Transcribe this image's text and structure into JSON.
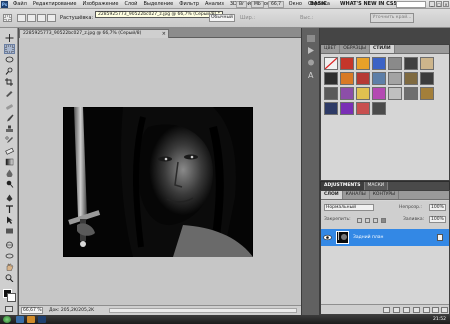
{
  "app": {
    "logo_text": "Ps",
    "menu": [
      "Файл",
      "Редактирование",
      "Изображение",
      "Слой",
      "Выделение",
      "Фильтр",
      "Анализ",
      "3D-слой",
      "Просмотр",
      "Окно",
      "Справка"
    ],
    "bar_buttons": [
      "Br",
      "Mb"
    ],
    "zoom_button": "66,7",
    "workspace_basic": "BASIC",
    "workspace_whatsnew": "WHAT'S NEW IN CS5",
    "window_controls": [
      "_",
      "□",
      "×"
    ]
  },
  "options": {
    "feather_label": "Растушёвка:",
    "feather_value": "0 пикс",
    "style_value": "Обычный",
    "width_label": "Шир.:",
    "height_label": "Выс.:",
    "refine_edge": "Уточнить край..."
  },
  "document": {
    "tab_title": "2285925773_90522bc027_z.jpg @ 66,7% (Серый/8)",
    "tooltip": "2285925773_90522bc027_z.jpg @ 66,7% (Серый/8) *",
    "zoom": "66,67 %",
    "doc_size": "Док: 205,2K/205,2K"
  },
  "panels": {
    "top_tabs": [
      "ЦВЕТ",
      "ОБРАЗЦЫ",
      "СТИЛИ"
    ],
    "top_active": 2,
    "adj_tabs": [
      "ADJUSTMENTS",
      "МАСКИ"
    ],
    "layer_tabs": [
      "СЛОИ",
      "КАНАЛЫ",
      "КОНТУРЫ"
    ],
    "blend_mode": "Нормальный",
    "opacity_label": "Непрозр.:",
    "opacity_value": "100%",
    "lock_label": "Закрепить:",
    "fill_label": "Заливка:",
    "fill_value": "100%",
    "layer_name": "Задний план"
  },
  "styles": {
    "swatch_colors": [
      "#f1f1f1",
      "#c5362a",
      "#e8a128",
      "#3c63c6",
      "#8a8a8a",
      "#404040",
      "#cdb58b",
      "#2e2e2e",
      "#d87a26",
      "#b63a34",
      "#5e7fa8",
      "#a3a3a3",
      "#7f6a40",
      "#3c3c3c",
      "#5a5a5a",
      "#8c4ea8",
      "#e0c150",
      "#b44ab2",
      "#bfbfbf",
      "#6e6e6e",
      "#a37f3a",
      "#2d3a66",
      "#7a2fb5",
      "#c85050",
      "#4b4b4b"
    ]
  },
  "colors": {
    "accent_selection": "#3388e5",
    "canvas_background": "#c6c6c6",
    "panel_background": "#d6d6d6"
  },
  "taskbar": {
    "clock": "21:52"
  }
}
